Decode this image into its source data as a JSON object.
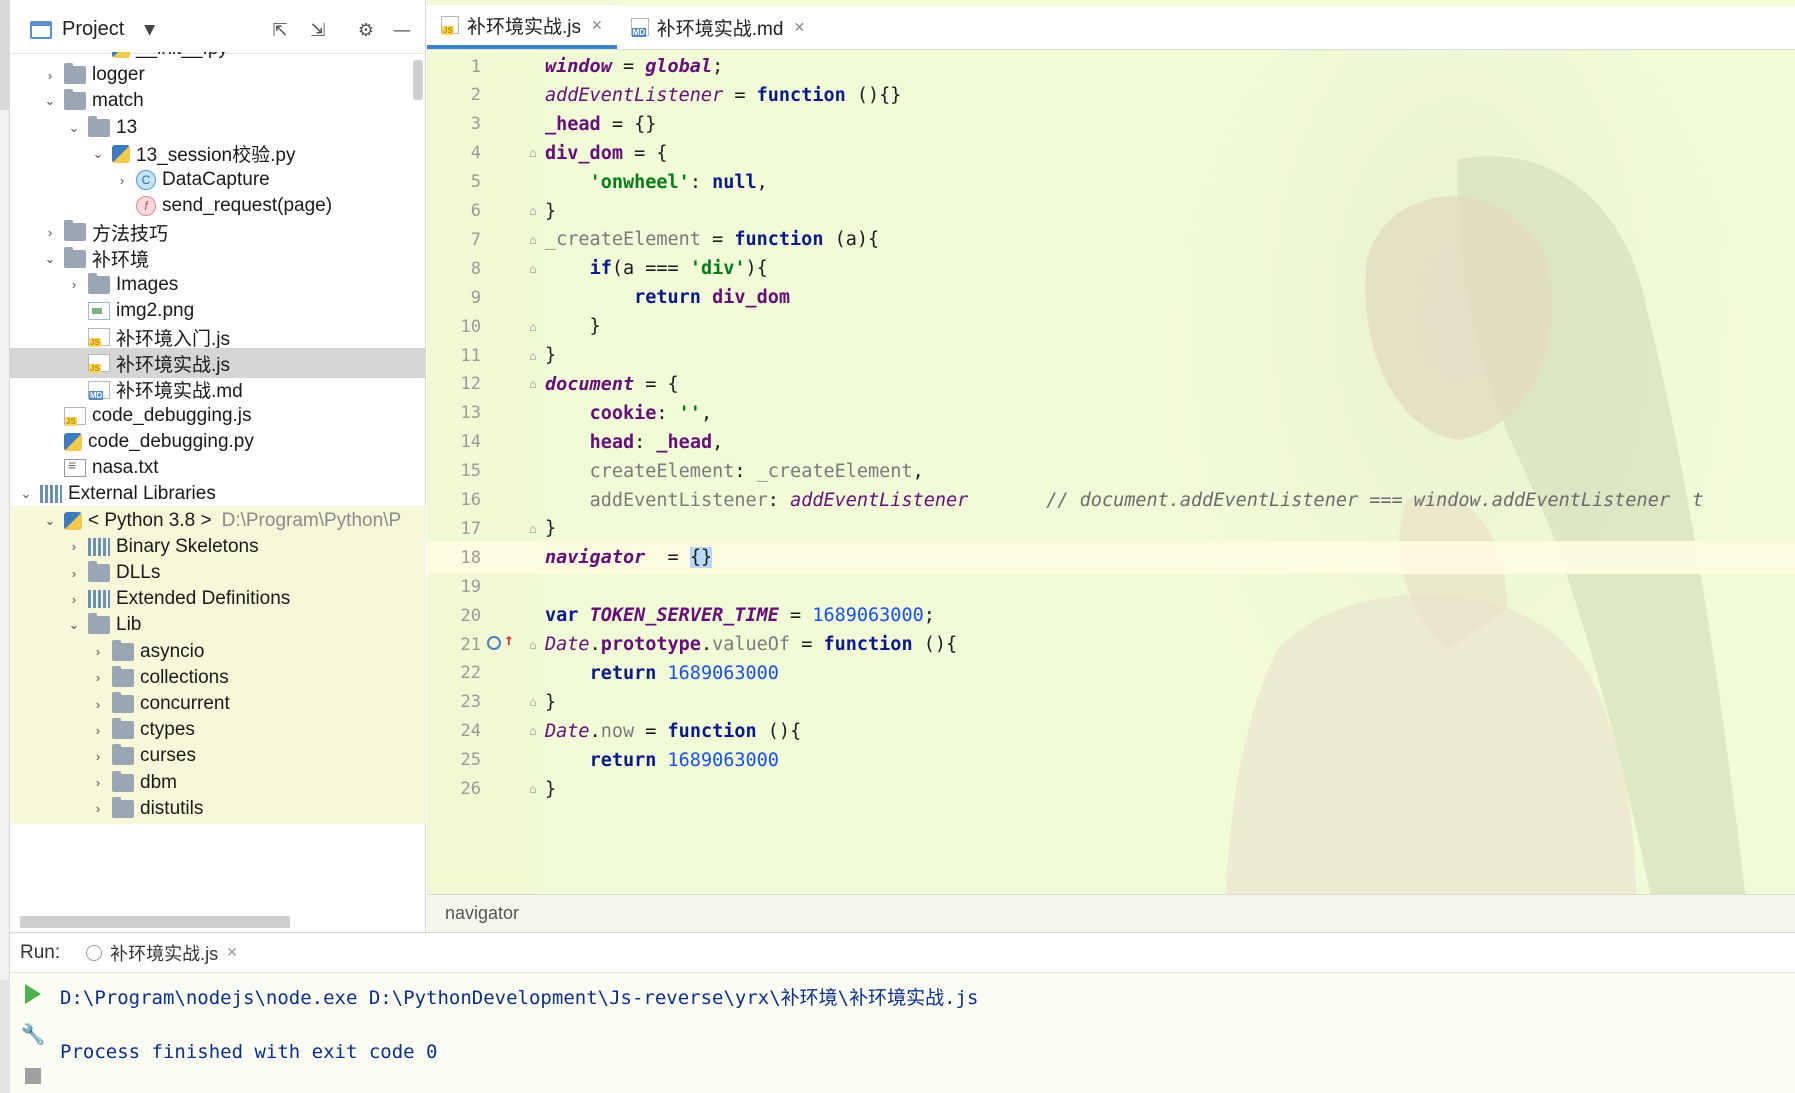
{
  "project": {
    "title": "Project",
    "tree": [
      {
        "label": "__init__.py",
        "icon": "py",
        "depth": 3,
        "chev": ""
      },
      {
        "label": "logger",
        "icon": "folder",
        "depth": 1,
        "chev": "›"
      },
      {
        "label": "match",
        "icon": "folder",
        "depth": 1,
        "chev": "⌄"
      },
      {
        "label": "13",
        "icon": "folder",
        "depth": 2,
        "chev": "⌄"
      },
      {
        "label": "13_session校验.py",
        "icon": "py",
        "depth": 3,
        "chev": "⌄"
      },
      {
        "label": "DataCapture",
        "icon": "class",
        "depth": 4,
        "chev": "›"
      },
      {
        "label": "send_request(page)",
        "icon": "func",
        "depth": 4,
        "chev": ""
      },
      {
        "label": "方法技巧",
        "icon": "folder",
        "depth": 1,
        "chev": "›"
      },
      {
        "label": "补环境",
        "icon": "folder",
        "depth": 1,
        "chev": "⌄"
      },
      {
        "label": "Images",
        "icon": "folder",
        "depth": 2,
        "chev": "›"
      },
      {
        "label": "img2.png",
        "icon": "png",
        "depth": 2,
        "chev": ""
      },
      {
        "label": "补环境入门.js",
        "icon": "js",
        "depth": 2,
        "chev": ""
      },
      {
        "label": "补环境实战.js",
        "icon": "js",
        "depth": 2,
        "chev": "",
        "selected": true
      },
      {
        "label": "补环境实战.md",
        "icon": "md",
        "depth": 2,
        "chev": ""
      },
      {
        "label": "code_debugging.js",
        "icon": "js",
        "depth": 1,
        "chev": ""
      },
      {
        "label": "code_debugging.py",
        "icon": "py",
        "depth": 1,
        "chev": ""
      },
      {
        "label": "nasa.txt",
        "icon": "txt",
        "depth": 1,
        "chev": ""
      },
      {
        "label": "External Libraries",
        "icon": "lib",
        "depth": 0,
        "chev": "⌄"
      },
      {
        "label": "< Python 3.8 >",
        "path": "D:\\Program\\Python\\P",
        "icon": "py",
        "depth": 1,
        "chev": "⌄",
        "lib": true
      },
      {
        "label": "Binary Skeletons",
        "icon": "lib",
        "depth": 2,
        "chev": "›",
        "lib": true
      },
      {
        "label": "DLLs",
        "icon": "folder",
        "depth": 2,
        "chev": "›",
        "lib": true
      },
      {
        "label": "Extended Definitions",
        "icon": "lib",
        "depth": 2,
        "chev": "›",
        "lib": true
      },
      {
        "label": "Lib",
        "icon": "folder",
        "depth": 2,
        "chev": "⌄",
        "lib": true
      },
      {
        "label": "asyncio",
        "icon": "folder",
        "depth": 3,
        "chev": "›",
        "lib": true
      },
      {
        "label": "collections",
        "icon": "folder",
        "depth": 3,
        "chev": "›",
        "lib": true
      },
      {
        "label": "concurrent",
        "icon": "folder",
        "depth": 3,
        "chev": "›",
        "lib": true
      },
      {
        "label": "ctypes",
        "icon": "folder",
        "depth": 3,
        "chev": "›",
        "lib": true
      },
      {
        "label": "curses",
        "icon": "folder",
        "depth": 3,
        "chev": "›",
        "lib": true
      },
      {
        "label": "dbm",
        "icon": "folder",
        "depth": 3,
        "chev": "›",
        "lib": true
      },
      {
        "label": "distutils",
        "icon": "folder",
        "depth": 3,
        "chev": "›",
        "lib": true
      }
    ]
  },
  "editor": {
    "tabs": [
      {
        "label": "补环境实战.js",
        "icon": "js",
        "active": true
      },
      {
        "label": "补环境实战.md",
        "icon": "md",
        "active": false
      }
    ],
    "current_line": 18,
    "lines": [
      [
        [
          "window",
          "gv"
        ],
        [
          " = ",
          ""
        ],
        [
          "global",
          "gv"
        ],
        [
          ";",
          ""
        ]
      ],
      [
        [
          "addEventListener",
          "gv-i"
        ],
        [
          " = ",
          ""
        ],
        [
          "function",
          "kw"
        ],
        [
          " (){}",
          ""
        ]
      ],
      [
        [
          "_head",
          "pv"
        ],
        [
          " = {}",
          ""
        ]
      ],
      [
        [
          "div_dom",
          "pv"
        ],
        [
          " = {",
          ""
        ]
      ],
      [
        [
          "    ",
          ""
        ],
        [
          "'onwheel'",
          "str"
        ],
        [
          ": ",
          ""
        ],
        [
          "null",
          "kw"
        ],
        [
          ",",
          ""
        ]
      ],
      [
        [
          "}",
          ""
        ]
      ],
      [
        [
          "_createElement",
          "unused"
        ],
        [
          " = ",
          ""
        ],
        [
          "function",
          "kw"
        ],
        [
          " (a){",
          ""
        ]
      ],
      [
        [
          "    ",
          ""
        ],
        [
          "if",
          "kw"
        ],
        [
          "(a === ",
          ""
        ],
        [
          "'div'",
          "str"
        ],
        [
          "){",
          ""
        ]
      ],
      [
        [
          "        ",
          ""
        ],
        [
          "return",
          "kw"
        ],
        [
          " ",
          ""
        ],
        [
          "div_dom",
          "pv"
        ]
      ],
      [
        [
          "    }",
          ""
        ]
      ],
      [
        [
          "}",
          ""
        ]
      ],
      [
        [
          "document",
          "gv"
        ],
        [
          " = {",
          ""
        ]
      ],
      [
        [
          "    ",
          ""
        ],
        [
          "cookie",
          "pv"
        ],
        [
          ": ",
          ""
        ],
        [
          "''",
          "str"
        ],
        [
          ",",
          ""
        ]
      ],
      [
        [
          "    ",
          ""
        ],
        [
          "head",
          "pv"
        ],
        [
          ": ",
          ""
        ],
        [
          "_head",
          "pv"
        ],
        [
          ",",
          ""
        ]
      ],
      [
        [
          "    ",
          ""
        ],
        [
          "createElement",
          "unused"
        ],
        [
          ": ",
          ""
        ],
        [
          "_createElement",
          "unused"
        ],
        [
          ",",
          ""
        ]
      ],
      [
        [
          "    ",
          ""
        ],
        [
          "addEventListener",
          "unused"
        ],
        [
          ": ",
          ""
        ],
        [
          "addEventListener",
          "gv-i"
        ],
        [
          "       ",
          ""
        ],
        [
          "// document.addEventListener === window.addEventListener  t",
          "cmt"
        ]
      ],
      [
        [
          "}",
          ""
        ]
      ],
      [
        [
          "navigator",
          "gv"
        ],
        [
          "  = ",
          ""
        ],
        [
          "{}",
          "brace-hl"
        ]
      ],
      [],
      [
        [
          "var",
          "kw"
        ],
        [
          " ",
          ""
        ],
        [
          "TOKEN_SERVER_TIME",
          "gv"
        ],
        [
          " = ",
          ""
        ],
        [
          "1689063000",
          "num"
        ],
        [
          ";",
          ""
        ]
      ],
      [
        [
          "Date",
          "gv-i"
        ],
        [
          ".",
          ""
        ],
        [
          "prototype",
          "pv"
        ],
        [
          ".",
          ""
        ],
        [
          "valueOf",
          "unused"
        ],
        [
          " = ",
          ""
        ],
        [
          "function",
          "kw"
        ],
        [
          " (){",
          ""
        ]
      ],
      [
        [
          "    ",
          ""
        ],
        [
          "return",
          "kw"
        ],
        [
          " ",
          ""
        ],
        [
          "1689063000",
          "num"
        ]
      ],
      [
        [
          "}",
          ""
        ]
      ],
      [
        [
          "Date",
          "gv-i"
        ],
        [
          ".",
          ""
        ],
        [
          "now",
          "unused"
        ],
        [
          " = ",
          ""
        ],
        [
          "function",
          "kw"
        ],
        [
          " (){",
          ""
        ]
      ],
      [
        [
          "    ",
          ""
        ],
        [
          "return",
          "kw"
        ],
        [
          " ",
          ""
        ],
        [
          "1689063000",
          "num"
        ]
      ],
      [
        [
          "}",
          ""
        ]
      ]
    ],
    "fold_lines": [
      4,
      6,
      7,
      8,
      10,
      11,
      12,
      17,
      21,
      23,
      24,
      26
    ],
    "breadcrumb": "navigator"
  },
  "run": {
    "label": "Run:",
    "tab_label": "补环境实战.js",
    "console": [
      "D:\\Program\\nodejs\\node.exe D:\\PythonDevelopment\\Js-reverse\\yrx\\补环境\\补环境实战.js",
      "",
      "Process finished with exit code 0"
    ]
  }
}
